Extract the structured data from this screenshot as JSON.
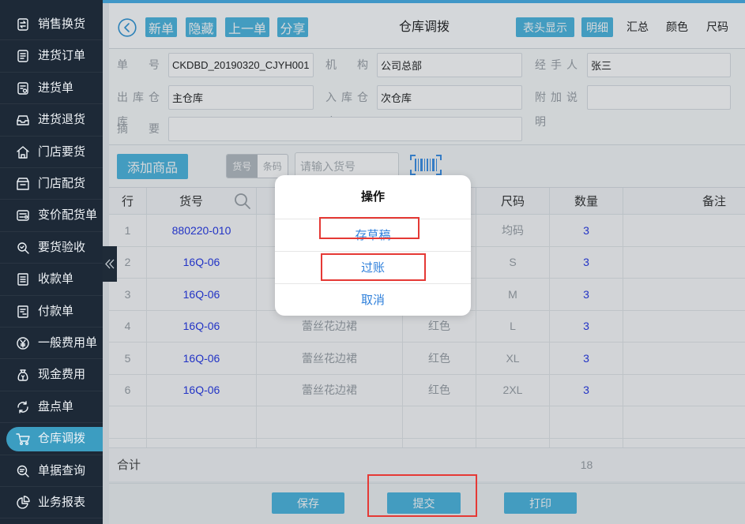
{
  "colors": {
    "accent": "#4cb6e0",
    "link_blue": "#2436e6",
    "dialog_blue": "#2f80db",
    "annotation_red": "#e53935",
    "sidebar_bg": "#1d2937",
    "sidebar_active": "#3c9dc1"
  },
  "sidebar": {
    "active_index": 13,
    "collapse_icon": "double-chevron-left-icon",
    "items": [
      {
        "label": "销售换货",
        "icon": "exchange-doc-icon"
      },
      {
        "label": "进货订单",
        "icon": "order-doc-icon"
      },
      {
        "label": "进货单",
        "icon": "purchase-doc-icon"
      },
      {
        "label": "进货退货",
        "icon": "return-tray-icon"
      },
      {
        "label": "门店要货",
        "icon": "store-icon"
      },
      {
        "label": "门店配货",
        "icon": "store-delivery-icon"
      },
      {
        "label": "变价配货单",
        "icon": "price-change-icon"
      },
      {
        "label": "要货验收",
        "icon": "inspection-icon"
      },
      {
        "label": "收款单",
        "icon": "receipt-icon"
      },
      {
        "label": "付款单",
        "icon": "payment-icon"
      },
      {
        "label": "一般费用单",
        "icon": "yen-icon"
      },
      {
        "label": "现金费用",
        "icon": "money-bag-icon"
      },
      {
        "label": "盘点单",
        "icon": "stocktake-icon"
      },
      {
        "label": "仓库调拨",
        "icon": "cart-icon"
      },
      {
        "label": "单据查询",
        "icon": "query-icon"
      },
      {
        "label": "业务报表",
        "icon": "pie-chart-icon"
      }
    ]
  },
  "header": {
    "back_icon": "back-circle-icon",
    "buttons": [
      "新单",
      "隐藏",
      "上一单",
      "分享"
    ],
    "title": "仓库调拨",
    "view_buttons": [
      "表头显示",
      "明细"
    ],
    "view_tabs": [
      "汇总",
      "颜色",
      "尺码"
    ]
  },
  "form": {
    "fields": [
      {
        "label": "单号",
        "value": "CKDBD_20190320_CJYH001"
      },
      {
        "label": "机构",
        "value": "公司总部"
      },
      {
        "label": "经手人",
        "value": "张三"
      },
      {
        "label": "出库仓库",
        "value": "主仓库"
      },
      {
        "label": "入库仓库",
        "value": "次仓库"
      },
      {
        "label": "附加说明",
        "value": ""
      },
      {
        "label": "摘要",
        "value": ""
      }
    ]
  },
  "toolbar": {
    "add_button": "添加商品",
    "mode_options": [
      "货号",
      "条码"
    ],
    "selected_mode_index": 0,
    "search_placeholder": "请输入货号",
    "barcode_icon": "barcode-scan-icon"
  },
  "table": {
    "columns": [
      "行",
      "货号",
      null,
      null,
      "尺码",
      "数量",
      "备注"
    ],
    "search_icon": "search-icon",
    "rows": [
      [
        "1",
        "880220-010",
        null,
        null,
        "均码",
        "3"
      ],
      [
        "2",
        "16Q-06",
        null,
        null,
        "S",
        "3"
      ],
      [
        "3",
        "16Q-06",
        null,
        null,
        "M",
        "3"
      ],
      [
        "4",
        "16Q-06",
        "蕾丝花边裙",
        "红色",
        "L",
        "3"
      ],
      [
        "5",
        "16Q-06",
        "蕾丝花边裙",
        "红色",
        "XL",
        "3"
      ],
      [
        "6",
        "16Q-06",
        "蕾丝花边裙",
        "红色",
        "2XL",
        "3"
      ]
    ]
  },
  "totals": {
    "label": "合计",
    "quantity": "18"
  },
  "footer": {
    "buttons": [
      "保存",
      "提交",
      "打印"
    ]
  },
  "dialog": {
    "title": "操作",
    "options": [
      "存草稿",
      "过账",
      "取消"
    ]
  }
}
